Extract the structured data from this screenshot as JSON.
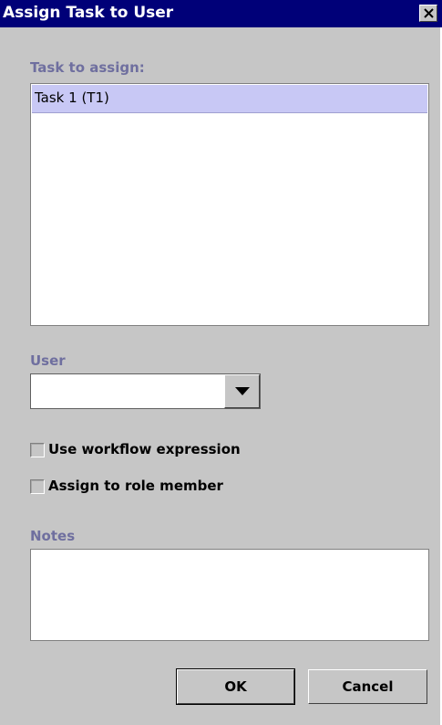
{
  "window": {
    "title": "Assign Task to User",
    "close_icon": "close-icon"
  },
  "task_section": {
    "label": "Task to assign:",
    "items": [
      "Task 1 (T1)"
    ],
    "selected_index": 0
  },
  "user_section": {
    "label": "User",
    "value": ""
  },
  "options": {
    "use_workflow_expression": {
      "label": "Use workflow expression",
      "checked": false
    },
    "assign_to_role_member": {
      "label": "Assign to role member",
      "checked": false
    }
  },
  "notes_section": {
    "label": "Notes",
    "value": ""
  },
  "buttons": {
    "ok": "OK",
    "cancel": "Cancel"
  },
  "colors": {
    "titlebar": "#000078",
    "dialog_bg": "#c6c6c6",
    "section_label": "#6f6f9f",
    "selection": "#c8c8f5"
  }
}
